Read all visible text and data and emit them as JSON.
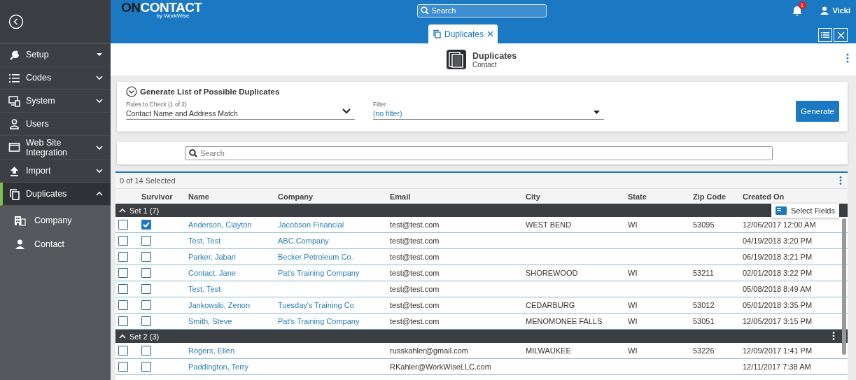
{
  "header": {
    "logo": {
      "part_1": "ON",
      "part_2": "CONTACT",
      "byline": "by WorkWise"
    },
    "search": {
      "placeholder": "Search"
    },
    "notifications": "1",
    "user": "Vicki"
  },
  "sidebar": {
    "items": [
      {
        "label": "Setup",
        "kind": "menu",
        "selected": false
      },
      {
        "label": "Codes",
        "kind": "group",
        "expanded": false,
        "selected": false
      },
      {
        "label": "System",
        "kind": "group",
        "expanded": false,
        "selected": false
      },
      {
        "label": "Users",
        "kind": "link",
        "selected": false
      },
      {
        "label": "Web Site Integration",
        "kind": "group",
        "expanded": false,
        "selected": false
      },
      {
        "label": "Import",
        "kind": "group",
        "expanded": false,
        "selected": false
      },
      {
        "label": "Duplicates",
        "kind": "group",
        "expanded": true,
        "selected": true,
        "children": [
          {
            "label": "Company"
          },
          {
            "label": "Contact"
          }
        ]
      }
    ]
  },
  "tabs": [
    {
      "label": "Duplicates",
      "selected": true
    }
  ],
  "page": {
    "title": "Duplicates",
    "subtitle": "Contact"
  },
  "generate_panel": {
    "title": "Generate List of Possible Duplicates",
    "expanded": true,
    "rules": {
      "label": "Rules to Check (1 of 2)",
      "value": "Contact Name and Address Match"
    },
    "filter": {
      "label": "Filter",
      "value": "(no filter)"
    },
    "button": "Generate"
  },
  "grid": {
    "search": {
      "placeholder": "Search"
    },
    "selection_count": "0 of 14 Selected",
    "columns": [
      "Survivor",
      "Name",
      "Company",
      "Email",
      "City",
      "State",
      "Zip Code",
      "Created On"
    ],
    "groups": [
      {
        "label": "Set 1 (7)",
        "expanded": true,
        "rows": [
          {
            "checked": false,
            "survivor": true,
            "cells": [
              "Anderson, Clayton",
              "Jacobson Financial",
              "test@test.com",
              "WEST BEND",
              "WI",
              "53095",
              "12/06/2017 12:00 AM"
            ]
          },
          {
            "checked": false,
            "survivor": false,
            "cells": [
              "Test, Test",
              "ABC Company",
              "test@test.com",
              "",
              "",
              "",
              "04/19/2018 3:20 PM"
            ]
          },
          {
            "checked": false,
            "survivor": false,
            "cells": [
              "Parker, Jabari",
              "Becker Petroleum Co.",
              "test@test.com",
              "",
              "",
              "",
              "06/19/2018 3:21 PM"
            ]
          },
          {
            "checked": false,
            "survivor": false,
            "cells": [
              "Contact, Jane",
              "Pat's Training Company",
              "test@test.com",
              "SHOREWOOD",
              "WI",
              "53211",
              "02/01/2018 3:22 PM"
            ]
          },
          {
            "checked": false,
            "survivor": false,
            "cells": [
              "Test, Test",
              "",
              "test@test.com",
              "",
              "",
              "",
              "05/08/2018 8:49 AM"
            ]
          },
          {
            "checked": false,
            "survivor": false,
            "cells": [
              "Jankowski, Zenon",
              "Tuesday's Training Co",
              "test@test.com",
              "CEDARBURG",
              "WI",
              "53012",
              "05/01/2018 3:35 PM"
            ]
          },
          {
            "checked": false,
            "survivor": false,
            "cells": [
              "Smith, Steve",
              "Pat's Training Company",
              "test@test.com",
              "MENOMONEE FALLS",
              "WI",
              "53051",
              "12/05/2017 3:15 PM"
            ]
          }
        ]
      },
      {
        "label": "Set 2 (3)",
        "expanded": true,
        "rows": [
          {
            "checked": false,
            "survivor": false,
            "cells": [
              "Rogers, Ellen",
              "",
              "russkahler@gmail.com",
              "MILWAUKEE",
              "WI",
              "53226",
              "12/09/2017 1:41 PM"
            ]
          },
          {
            "checked": false,
            "survivor": false,
            "cells": [
              "Paddington, Terry",
              "",
              "RKahler@WorkWiseLLC.com",
              "",
              "",
              "",
              "12/11/2017 7:38 AM"
            ]
          }
        ]
      }
    ],
    "popup": {
      "label": "Select Fields"
    }
  }
}
